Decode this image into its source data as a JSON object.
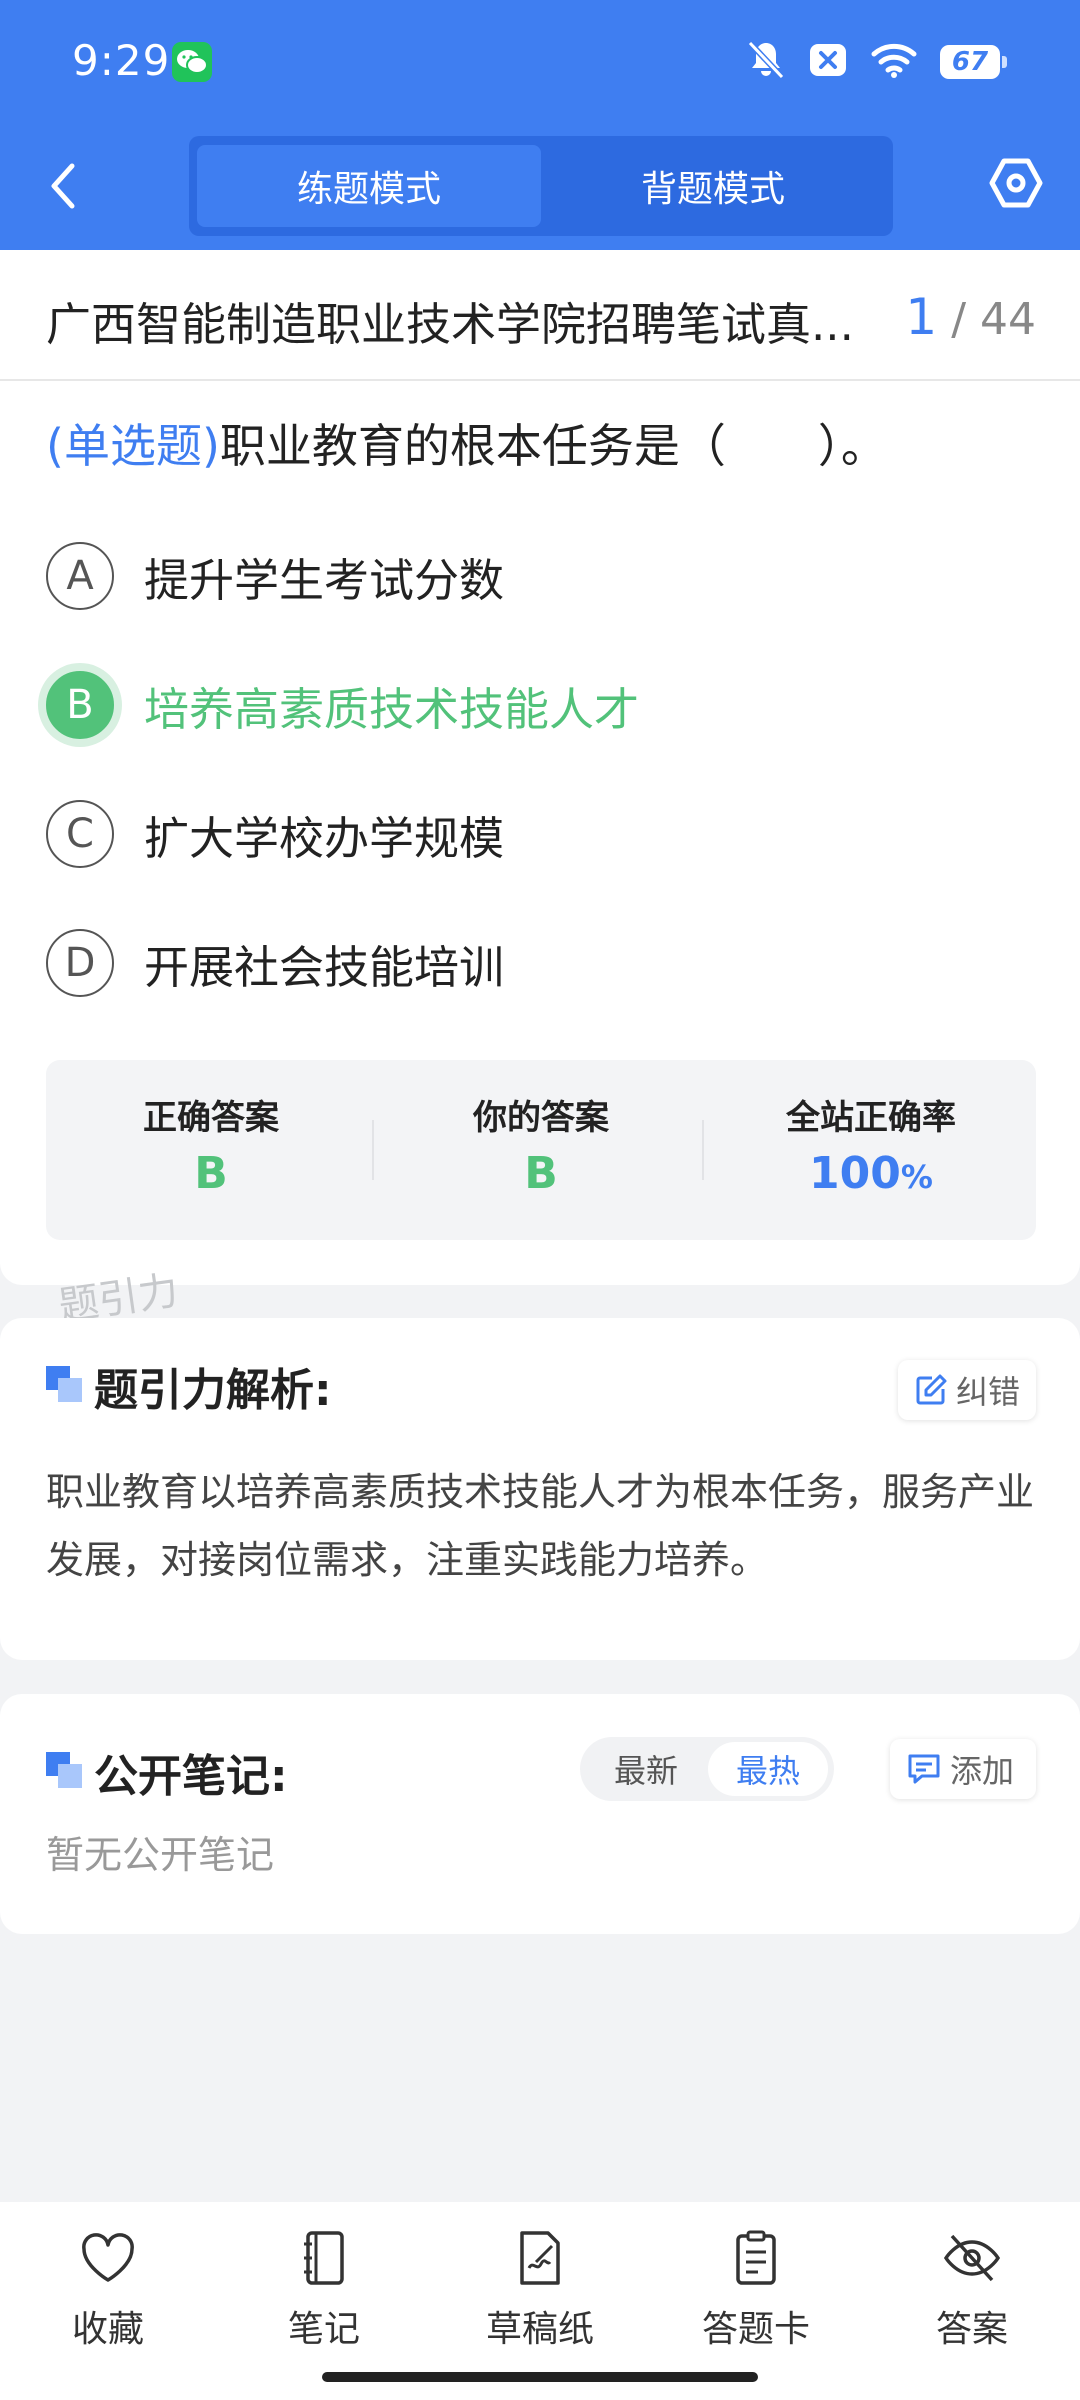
{
  "status_bar": {
    "time": "9:29",
    "battery": "67",
    "icons": [
      "wechat-icon",
      "mute-icon",
      "close-box-icon",
      "wifi-icon",
      "battery-icon"
    ]
  },
  "header": {
    "back_icon": "chevron-left-icon",
    "tabs": [
      {
        "label": "练题模式",
        "active": true
      },
      {
        "label": "背题模式",
        "active": false
      }
    ],
    "settings_icon": "settings-hex-icon"
  },
  "question_card": {
    "exam_title": "广西智能制造职业技术学院招聘笔试真...",
    "progress_current": "1",
    "progress_total": "/ 44",
    "question_type": "(单选题)",
    "question_text": "职业教育的根本任务是（　　）。",
    "options": [
      {
        "letter": "A",
        "text": "提升学生考试分数",
        "state": "normal"
      },
      {
        "letter": "B",
        "text": "培养高素质技术技能人才",
        "state": "correct"
      },
      {
        "letter": "C",
        "text": "扩大学校办学规模",
        "state": "normal"
      },
      {
        "letter": "D",
        "text": "开展社会技能培训",
        "state": "normal"
      }
    ],
    "answer_summary": {
      "correct_label": "正确答案",
      "correct_value": "B",
      "yours_label": "你的答案",
      "yours_value": "B",
      "rate_label": "全站正确率",
      "rate_value": "100",
      "rate_unit": "%"
    },
    "watermark": "题引力"
  },
  "analysis": {
    "title": "题引力解析:",
    "report_button": "纠错",
    "text": "职业教育以培养高素质技术技能人才为根本任务，服务产业发展，对接岗位需求，注重实践能力培养。"
  },
  "notes": {
    "title": "公开笔记:",
    "sort_latest": "最新",
    "sort_hot": "最热",
    "add_button": "添加",
    "empty_text": "暂无公开笔记"
  },
  "bottom_nav": {
    "items": [
      {
        "label": "收藏",
        "icon": "heart-icon"
      },
      {
        "label": "笔记",
        "icon": "notebook-icon"
      },
      {
        "label": "草稿纸",
        "icon": "draft-paper-icon"
      },
      {
        "label": "答题卡",
        "icon": "answer-sheet-icon"
      },
      {
        "label": "答案",
        "icon": "eye-off-icon"
      }
    ]
  },
  "colors": {
    "primary": "#3f7ef1",
    "correct": "#52c27a"
  }
}
